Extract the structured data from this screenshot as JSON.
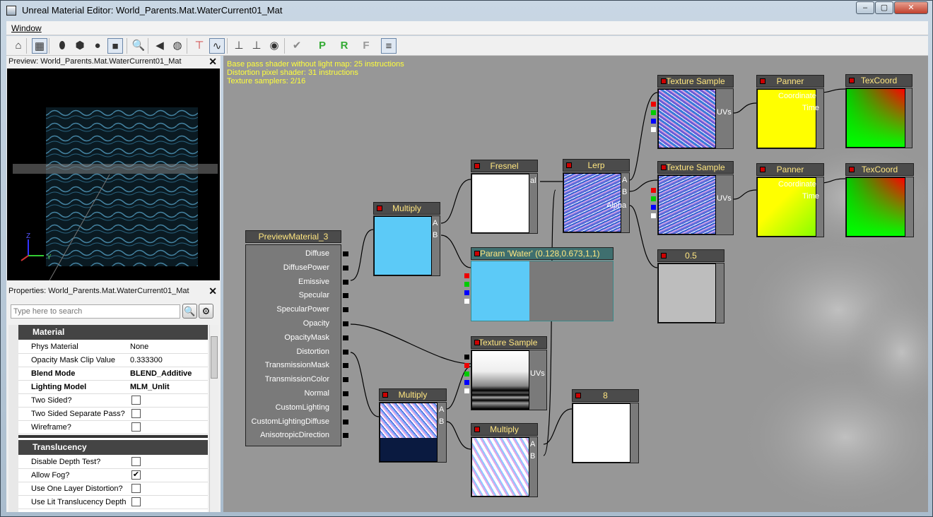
{
  "window": {
    "title": "Unreal Material Editor: World_Parents.Mat.WaterCurrent01_Mat",
    "controls": [
      "–",
      "▢",
      "✕"
    ]
  },
  "menu": {
    "items": [
      "Window"
    ]
  },
  "toolbar": {
    "buttons": [
      {
        "name": "home-icon",
        "glyph": "⌂"
      },
      {
        "name": "grid-icon",
        "glyph": "▦"
      },
      {
        "name": "cylinder-icon",
        "glyph": "⬮"
      },
      {
        "name": "cube-icon",
        "glyph": "⬢"
      },
      {
        "name": "sphere-icon",
        "glyph": "●"
      },
      {
        "name": "plane-icon",
        "glyph": "■"
      },
      {
        "name": "zoom-icon",
        "glyph": "🔍"
      },
      {
        "name": "back-arrow-icon",
        "glyph": "◀"
      },
      {
        "name": "globe-icon",
        "glyph": "◍"
      },
      {
        "name": "pin-icon",
        "glyph": "⊤"
      },
      {
        "name": "curve-icon",
        "glyph": "∿"
      },
      {
        "name": "connect-icon",
        "glyph": "⊥"
      },
      {
        "name": "disconnect-icon",
        "glyph": "⊥"
      },
      {
        "name": "eye-icon",
        "glyph": "◉"
      },
      {
        "name": "apply-check-icon",
        "glyph": "✔"
      },
      {
        "name": "p-icon",
        "glyph": "P"
      },
      {
        "name": "r-icon",
        "glyph": "R"
      },
      {
        "name": "f-icon",
        "glyph": "F"
      },
      {
        "name": "text-icon",
        "glyph": "≡"
      }
    ]
  },
  "preview": {
    "title": "Preview: World_Parents.Mat.WaterCurrent01_Mat",
    "axis_y": "Y",
    "axis_z": "Z"
  },
  "properties": {
    "title": "Properties: World_Parents.Mat.WaterCurrent01_Mat",
    "search_placeholder": "Type here to search",
    "categories": [
      {
        "name": "Material",
        "rows": [
          {
            "key": "Phys Material",
            "value": "None"
          },
          {
            "key": "Opacity Mask Clip Value",
            "value": "0.333300"
          },
          {
            "key": "Blend Mode",
            "value": "BLEND_Additive",
            "bold": true
          },
          {
            "key": "Lighting Model",
            "value": "MLM_Unlit",
            "bold": true
          },
          {
            "key": "Two Sided?",
            "checkbox": false
          },
          {
            "key": "Two Sided Separate Pass?",
            "checkbox": false
          },
          {
            "key": "Wireframe?",
            "checkbox": false
          }
        ]
      },
      {
        "name": "Translucency",
        "rows": [
          {
            "key": "Disable Depth Test?",
            "checkbox": false
          },
          {
            "key": "Allow Fog?",
            "checkbox": true
          },
          {
            "key": "Use One Layer Distortion?",
            "checkbox": false
          },
          {
            "key": "Use Lit Translucency Depth Pass?",
            "checkbox": false
          }
        ]
      }
    ]
  },
  "stats": [
    "Base pass shader without light map: 25 instructions",
    "Distortion pixel shader: 31 instructions",
    "Texture samplers: 2/16"
  ],
  "nodes": {
    "preview_material": {
      "title": "PreviewMaterial_3",
      "inputs": [
        "Diffuse",
        "DiffusePower",
        "Emissive",
        "Specular",
        "SpecularPower",
        "Opacity",
        "OpacityMask",
        "Distortion",
        "TransmissionMask",
        "TransmissionColor",
        "Normal",
        "CustomLighting",
        "CustomLightingDiffuse",
        "AnisotropicDirection"
      ]
    },
    "multiply_top": {
      "title": "Multiply",
      "a": "A",
      "b": "B"
    },
    "multiply_bottom": {
      "title": "Multiply",
      "a": "A",
      "b": "B"
    },
    "multiply_lower": {
      "title": "Multiply",
      "a": "A",
      "b": "B"
    },
    "fresnel": {
      "title": "Fresnel",
      "out": "al"
    },
    "param_water": {
      "title": "Param 'Water' (0.128,0.673,1,1)"
    },
    "lerp": {
      "title": "Lerp",
      "a": "A",
      "b": "B",
      "alpha": "Alpha"
    },
    "tex_sample_1": {
      "title": "Texture Sample",
      "uvs": "UVs"
    },
    "tex_sample_2": {
      "title": "Texture Sample",
      "uvs": "UVs"
    },
    "tex_sample_3": {
      "title": "Texture Sample",
      "uvs": "UVs"
    },
    "panner_1": {
      "title": "Panner",
      "coord": "Coordinate",
      "time": "Time"
    },
    "panner_2": {
      "title": "Panner",
      "coord": "Coordinate",
      "time": "Time"
    },
    "texcoord_1": {
      "title": "TexCoord"
    },
    "texcoord_2": {
      "title": "TexCoord"
    },
    "const_05": {
      "title": "0.5"
    },
    "const_8": {
      "title": "8"
    }
  }
}
